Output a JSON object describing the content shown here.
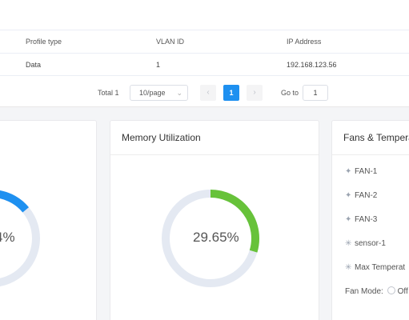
{
  "table": {
    "columns": [
      "Profile type",
      "VLAN ID",
      "IP Address"
    ],
    "rows": [
      [
        "Data",
        "1",
        "192.168.123.56"
      ]
    ]
  },
  "pager": {
    "total": "Total 1",
    "page_size": "10/page",
    "current_page": "1",
    "goto_label": "Go to",
    "goto_value": "1"
  },
  "cpu": {
    "percent_text": "4%",
    "value_fraction": 0.14,
    "color": "#1e90f0"
  },
  "memory": {
    "title": "Memory Utilization",
    "percent_text": "29.65%",
    "value_fraction": 0.2965,
    "color": "#67c23a",
    "track_color": "#e4e9f2"
  },
  "fans": {
    "title": "Fans & Tempera",
    "items": [
      {
        "label": "FAN-1",
        "icon": "fan-icon"
      },
      {
        "label": "FAN-2",
        "icon": "fan-icon"
      },
      {
        "label": "FAN-3",
        "icon": "fan-icon"
      },
      {
        "label": "sensor-1",
        "icon": "temperature-icon"
      },
      {
        "label": "Max Temperat",
        "icon": "temperature-icon"
      }
    ],
    "mode_label": "Fan Mode:",
    "mode_option": "Off"
  }
}
